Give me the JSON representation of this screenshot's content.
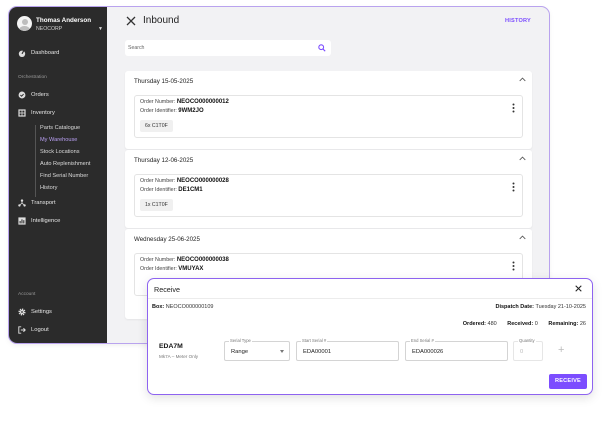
{
  "user": {
    "name": "Thomas Anderson",
    "org": "NEOCORP"
  },
  "sidebar": {
    "dashboard": "Dashboard",
    "section_orchestration": "Orchestration",
    "orders": "Orders",
    "inventory": "Inventory",
    "inventory_items": [
      "Parts Catalogue",
      "My Warehouse",
      "Stock Locations",
      "Auto Replenishment",
      "Find Serial Number",
      "History"
    ],
    "active_item": "My Warehouse",
    "transport": "Transport",
    "intelligence": "Intelligence",
    "section_account": "Account",
    "settings": "Settings",
    "logout": "Logout"
  },
  "header": {
    "title": "Inbound",
    "history_link": "HISTORY"
  },
  "search": {
    "placeholder": "Search"
  },
  "groups": [
    {
      "date": "Thursday 15-05-2025",
      "order_number_label": "Order Number:",
      "order_number": "NEOCO000000012",
      "order_identifier_label": "Order Identifier:",
      "order_identifier": "9WM2JO",
      "chip": "6x  C1T0F"
    },
    {
      "date": "Thursday 12-06-2025",
      "order_number_label": "Order Number:",
      "order_number": "NEOCO000000028",
      "order_identifier_label": "Order Identifier:",
      "order_identifier": "DE1CM1",
      "chip": "1x  C1T0F"
    },
    {
      "date": "Wednesday 25-06-2025",
      "order_number_label": "Order Number:",
      "order_number": "NEOCO000000038",
      "order_identifier_label": "Order Identifier:",
      "order_identifier": "VMUYAX"
    }
  ],
  "dialog": {
    "title": "Receive",
    "box_label": "Box:",
    "box_value": "NEOCO000000109",
    "dispatch_label": "Dispatch Date:",
    "dispatch_value": "Tuesday 21-10-2025",
    "ordered_label": "Ordered:",
    "ordered_value": "480",
    "received_label": "Received:",
    "received_value": "0",
    "remaining_label": "Remaining:",
    "remaining_value": "26",
    "item_code": "EDA7M",
    "item_desc": "Mk7A – Meter Only",
    "serial_type_label": "Serial Type",
    "serial_type_value": "Range",
    "start_serial_label": "Start Serial #",
    "start_serial_value": "EDA00001",
    "end_serial_label": "End Serial #",
    "end_serial_value": "EDA000026",
    "quantity_label": "Quantity",
    "quantity_value": "0",
    "receive_button": "RECEIVE"
  },
  "colors": {
    "accent": "#7c4dff",
    "sidebar_bg": "#2b2b2b",
    "active_nav": "#b89ff2"
  }
}
